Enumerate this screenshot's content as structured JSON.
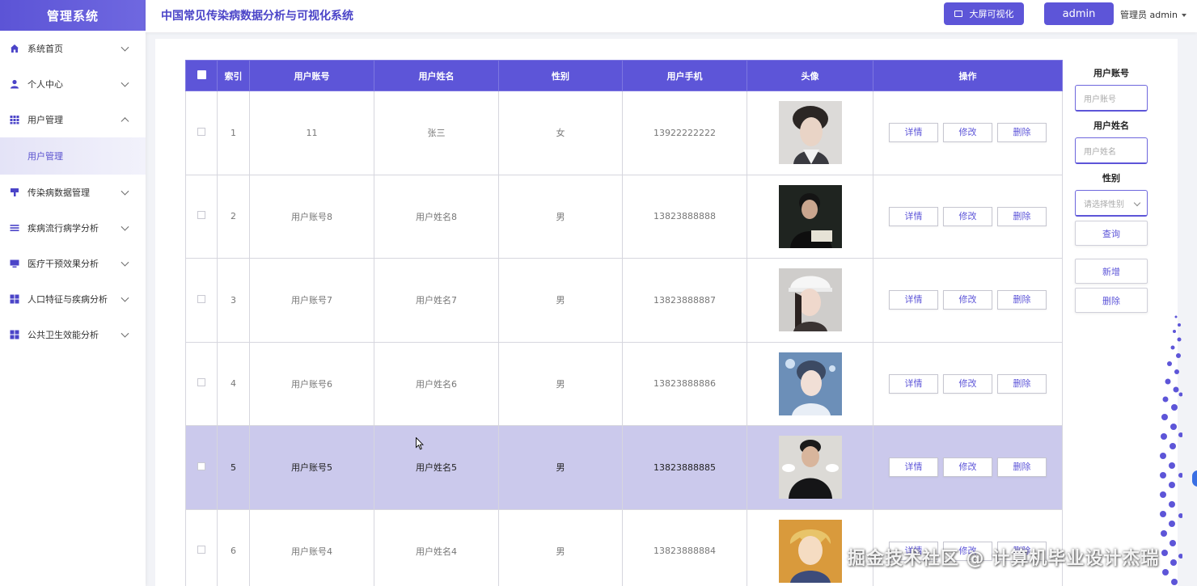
{
  "brand": "管理系统",
  "sidebar": {
    "items": [
      {
        "label": "系统首页",
        "icon": "home-icon",
        "expanded": false
      },
      {
        "label": "个人中心",
        "icon": "user-icon",
        "expanded": false
      },
      {
        "label": "用户管理",
        "icon": "grid-icon",
        "expanded": true
      },
      {
        "label": "传染病数据管理",
        "icon": "brush-icon",
        "expanded": false
      },
      {
        "label": "疾病流行病学分析",
        "icon": "list-icon",
        "expanded": false
      },
      {
        "label": "医疗干预效果分析",
        "icon": "monitor-icon",
        "expanded": false
      },
      {
        "label": "人口特征与疾病分析",
        "icon": "grid-icon",
        "expanded": false
      },
      {
        "label": "公共卫生效能分析",
        "icon": "grid-icon",
        "expanded": false
      }
    ],
    "submenu": {
      "label": "用户管理"
    }
  },
  "header": {
    "title": "中国常见传染病数据分析与可视化系统",
    "screen_button": "大屏可视化",
    "admin_button": "admin",
    "user_label": "管理员 admin"
  },
  "table": {
    "columns": [
      "索引",
      "用户账号",
      "用户姓名",
      "性别",
      "用户手机",
      "头像",
      "操作"
    ],
    "rows": [
      {
        "index": "1",
        "account": "11",
        "name": "张三",
        "gender": "女",
        "phone": "13922222222"
      },
      {
        "index": "2",
        "account": "用户账号8",
        "name": "用户姓名8",
        "gender": "男",
        "phone": "13823888888"
      },
      {
        "index": "3",
        "account": "用户账号7",
        "name": "用户姓名7",
        "gender": "男",
        "phone": "13823888887"
      },
      {
        "index": "4",
        "account": "用户账号6",
        "name": "用户姓名6",
        "gender": "男",
        "phone": "13823888886"
      },
      {
        "index": "5",
        "account": "用户账号5",
        "name": "用户姓名5",
        "gender": "男",
        "phone": "13823888885"
      },
      {
        "index": "6",
        "account": "用户账号4",
        "name": "用户姓名4",
        "gender": "男",
        "phone": "13823888884"
      }
    ],
    "actions": {
      "detail": "详情",
      "edit": "修改",
      "delete": "删除"
    }
  },
  "search": {
    "account_label": "用户账号",
    "account_placeholder": "用户账号",
    "name_label": "用户姓名",
    "name_placeholder": "用户姓名",
    "gender_label": "性别",
    "gender_placeholder": "请选择性别",
    "query_button": "查询",
    "add_button": "新增",
    "delete_button": "删除"
  },
  "watermark": "掘金技术社区 @ 计算机毕业设计杰瑞",
  "colors": {
    "primary": "#5d55d8",
    "highlight_row": "#cbc9ec",
    "sidebar_active": "#e4e3f7"
  }
}
